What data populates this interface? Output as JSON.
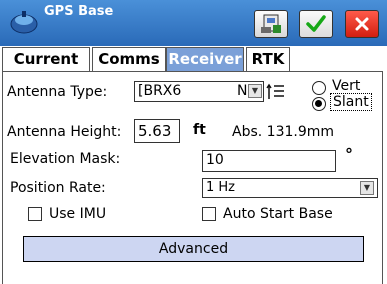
{
  "window": {
    "title": "GPS Base"
  },
  "tabs": [
    {
      "label": "Current"
    },
    {
      "label": "Comms"
    },
    {
      "label": "Receiver"
    },
    {
      "label": "RTK"
    }
  ],
  "active_tab": "Receiver",
  "antenna_type": {
    "label": "Antenna Type:",
    "value": "[BRX6",
    "suffix": "N"
  },
  "measure_options": [
    {
      "label": "Vert",
      "selected": false
    },
    {
      "label": "Slant",
      "selected": true
    }
  ],
  "antenna_height": {
    "label": "Antenna Height:",
    "value": "5.63",
    "unit": "ft",
    "abs": "Abs. 131.9mm"
  },
  "elevation_mask": {
    "label": "Elevation Mask:",
    "value": "10",
    "unit": "°"
  },
  "position_rate": {
    "label": "Position Rate:",
    "value": "1 Hz"
  },
  "use_imu": {
    "label": "Use IMU",
    "checked": false
  },
  "auto_start_base": {
    "label": "Auto Start Base",
    "checked": false
  },
  "advanced_button": {
    "label": "Advanced"
  },
  "colors": {
    "title_bar": "#3a7fcc",
    "active_tab": "#7ba0d8",
    "advanced_button": "#cdd6f2",
    "cancel": "#e0301f"
  }
}
